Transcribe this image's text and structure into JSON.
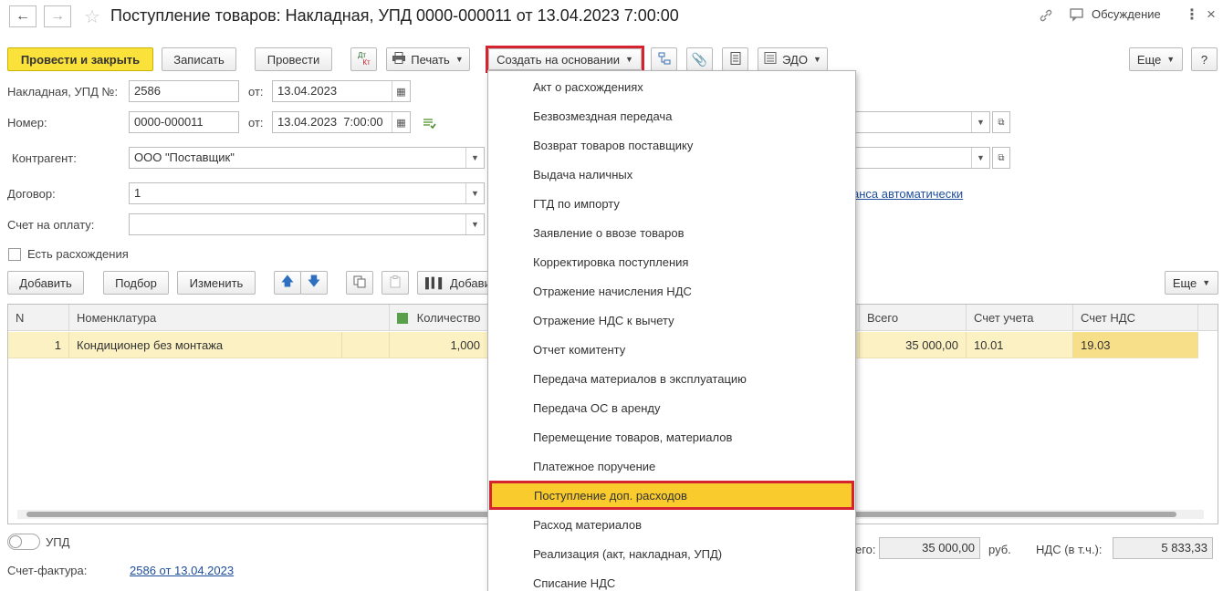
{
  "window": {
    "title": "Поступление товаров: Накладная, УПД 0000-000011 от 13.04.2023 7:00:00",
    "back_icon": "←",
    "forward_icon": "→",
    "discussion_label": "Обсуждение"
  },
  "toolbar": {
    "post_close": "Провести и закрыть",
    "save": "Записать",
    "post": "Провести",
    "dtkt_top": "Дт",
    "dtkt_bottom": "Кт",
    "print": "Печать",
    "create_based": "Создать на основании",
    "edo": "ЭДО",
    "more": "Еще",
    "help": "?"
  },
  "form": {
    "invoice_label": "Накладная, УПД №:",
    "invoice_value": "2586",
    "from_label": "от:",
    "invoice_date": "13.04.2023",
    "number_label": "Номер:",
    "number_value": "0000-000011",
    "number_from_label": "от:",
    "number_date": "13.04.2023  7:00:00",
    "contractor_label": "Контрагент:",
    "contractor_value": "ООО \"Поставщик\"",
    "contract_label": "Договор:",
    "contract_value": "1",
    "payment_label": "Счет на оплату:",
    "payment_value": "",
    "advance_link": "анса автоматически",
    "discrepancy_label": "Есть расхождения",
    "discrepancy_checked": false
  },
  "table_toolbar": {
    "add": "Добавить",
    "pick": "Подбор",
    "change": "Изменить",
    "add_barcode": "Добавит",
    "more": "Еще"
  },
  "table": {
    "headers": {
      "n": "N",
      "item": "Номенклатура",
      "qty": "Количество",
      "total": "Всего",
      "account": "Счет учета",
      "vat_account": "Счет НДС"
    },
    "rows": [
      {
        "n": "1",
        "item": "Кондиционер без монтажа",
        "qty": "1,000",
        "total": "35 000,00",
        "account": "10.01",
        "vat_account": "19.03"
      }
    ]
  },
  "footer": {
    "upd_label": "УПД",
    "upd_toggle_on": false,
    "total_label_fragment": "его:",
    "total_value": "35 000,00",
    "currency": "руб.",
    "vat_label": "НДС (в т.ч.):",
    "vat_value": "5 833,33",
    "invoice_label": "Счет-фактура:",
    "invoice_link": "2586 от 13.04.2023"
  },
  "menu": {
    "items": [
      "Акт о расхождениях",
      "Безвозмездная передача",
      "Возврат товаров поставщику",
      "Выдача наличных",
      "ГТД по импорту",
      "Заявление о ввозе товаров",
      "Корректировка поступления",
      "Отражение начисления НДС",
      "Отражение НДС к вычету",
      "Отчет комитенту",
      "Передача материалов в эксплуатацию",
      "Передача ОС в аренду",
      "Перемещение товаров, материалов",
      "Платежное поручение",
      "Поступление доп. расходов",
      "Расход материалов",
      "Реализация (акт, накладная, УПД)",
      "Списание НДС"
    ],
    "highlighted_index": 14
  },
  "colors": {
    "primary_button": "#fbe23a",
    "highlight": "#f9cb2c",
    "red_outline": "#d5232f",
    "selected_row": "#fbf1c3",
    "link": "#1e4e9a"
  }
}
